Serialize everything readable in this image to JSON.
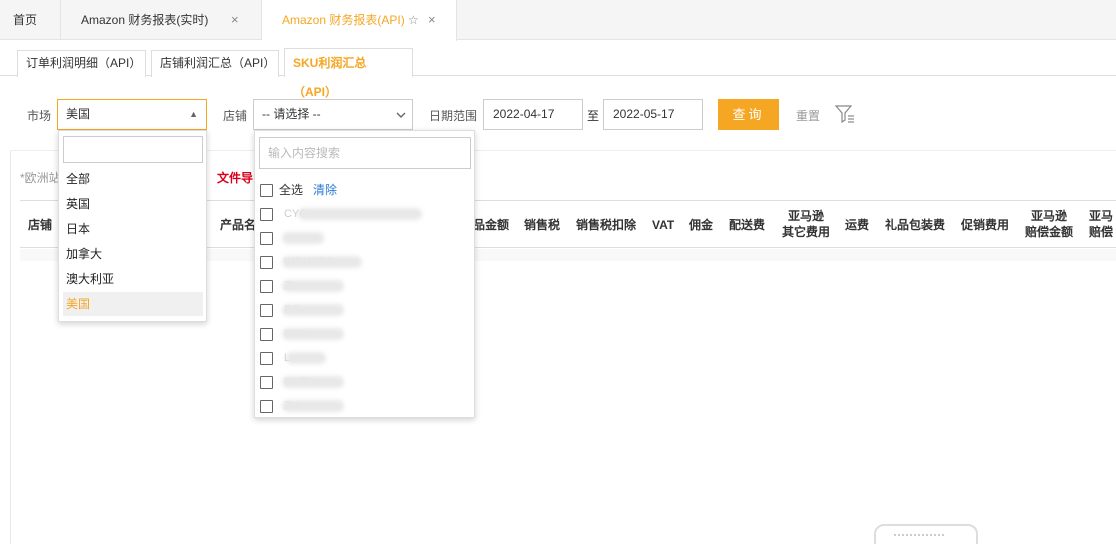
{
  "top_tabs": {
    "home": "首页",
    "tab1": "Amazon 财务报表(实时)",
    "tab2": "Amazon 财务报表(API)",
    "close_glyph": "×",
    "star_glyph": "☆"
  },
  "sub_tabs": [
    "订单利润明细（API）",
    "店铺利润汇总（API）",
    "SKU利润汇总（API）"
  ],
  "filters": {
    "market_label": "市场",
    "market_value": "美国",
    "store_label": "店铺",
    "store_placeholder": "-- 请选择 --",
    "date_label": "日期范围",
    "date_from": "2022-04-17",
    "to_label": "至",
    "date_to": "2022-05-17",
    "query_label": "查询",
    "reset_label": "重置"
  },
  "note": "*欧洲站",
  "export_label": "文件导",
  "columns": {
    "store": "店铺",
    "product": "产品名",
    "amount": "品金额",
    "sales_tax": "销售税",
    "tax_deduct": "销售税扣除",
    "vat": "VAT",
    "commission": "佣金",
    "delivery": "配送费",
    "amazon_other_1": "亚马逊",
    "amazon_other_2": "其它费用",
    "shipping": "运费",
    "gift_wrap": "礼品包装费",
    "promo": "促销费用",
    "comp_1": "亚马逊",
    "comp_2": "赔偿金额",
    "last_1": "亚马",
    "last_2": "赔偿"
  },
  "market_dropdown": {
    "options": [
      "全部",
      "英国",
      "日本",
      "加拿大",
      "澳大利亚",
      "美国"
    ],
    "selected": "美国"
  },
  "store_dropdown": {
    "search_placeholder": "输入内容搜索",
    "select_all": "全选",
    "clear": "清除",
    "items": [
      "CYC",
      "",
      "WGNSTO",
      "Zh",
      "RE",
      "OHH",
      "L",
      "OYRY",
      "ZH"
    ]
  },
  "colors": {
    "accent": "#f5a623",
    "export_red": "#d9001b",
    "link_blue": "#2a7ad2"
  }
}
